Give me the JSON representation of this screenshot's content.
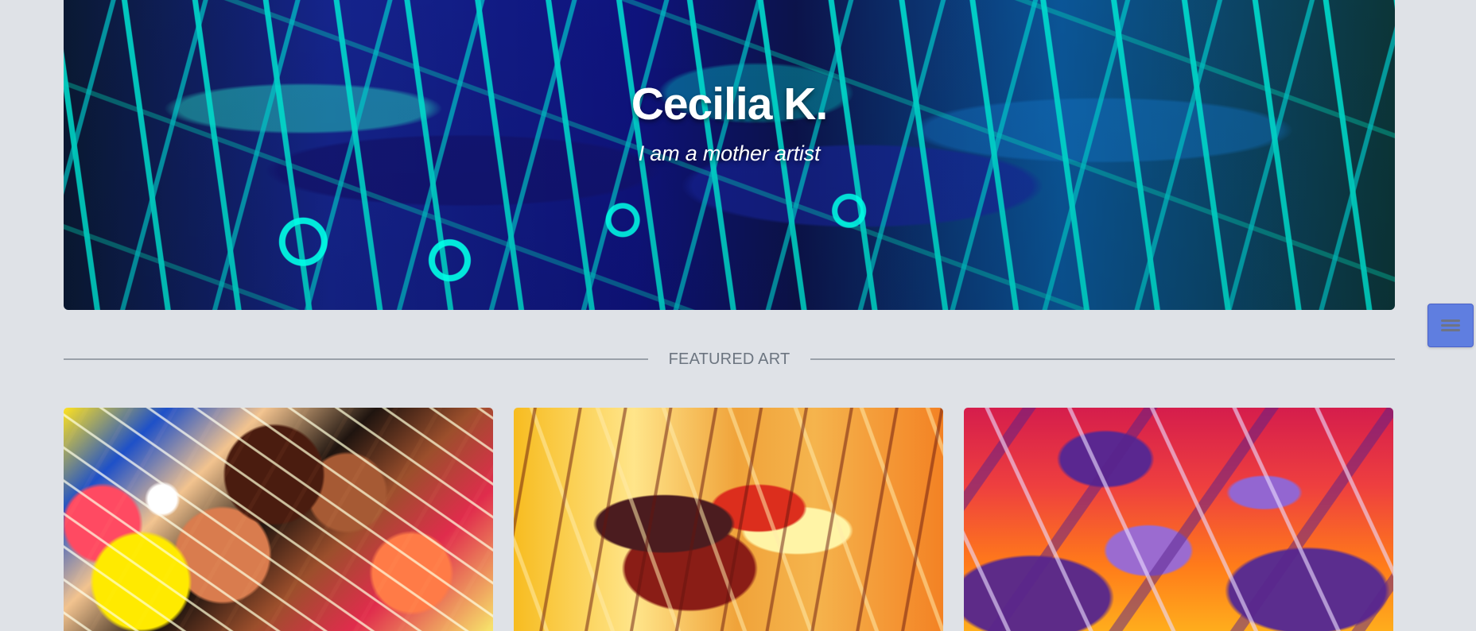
{
  "hero": {
    "title": "Cecilia K.",
    "subtitle": "I am a mother artist",
    "image_icon": "portrait-artwork-icon"
  },
  "navigation": {
    "menu_icon": "hamburger-menu-icon",
    "accent_color": "#5f7ee0"
  },
  "featured": {
    "label": "FEATURED ART",
    "items": [
      {
        "image_icon": "colorful-figure-art-icon"
      },
      {
        "image_icon": "sunset-horse-art-icon"
      },
      {
        "image_icon": "purple-tulip-art-icon"
      }
    ]
  }
}
